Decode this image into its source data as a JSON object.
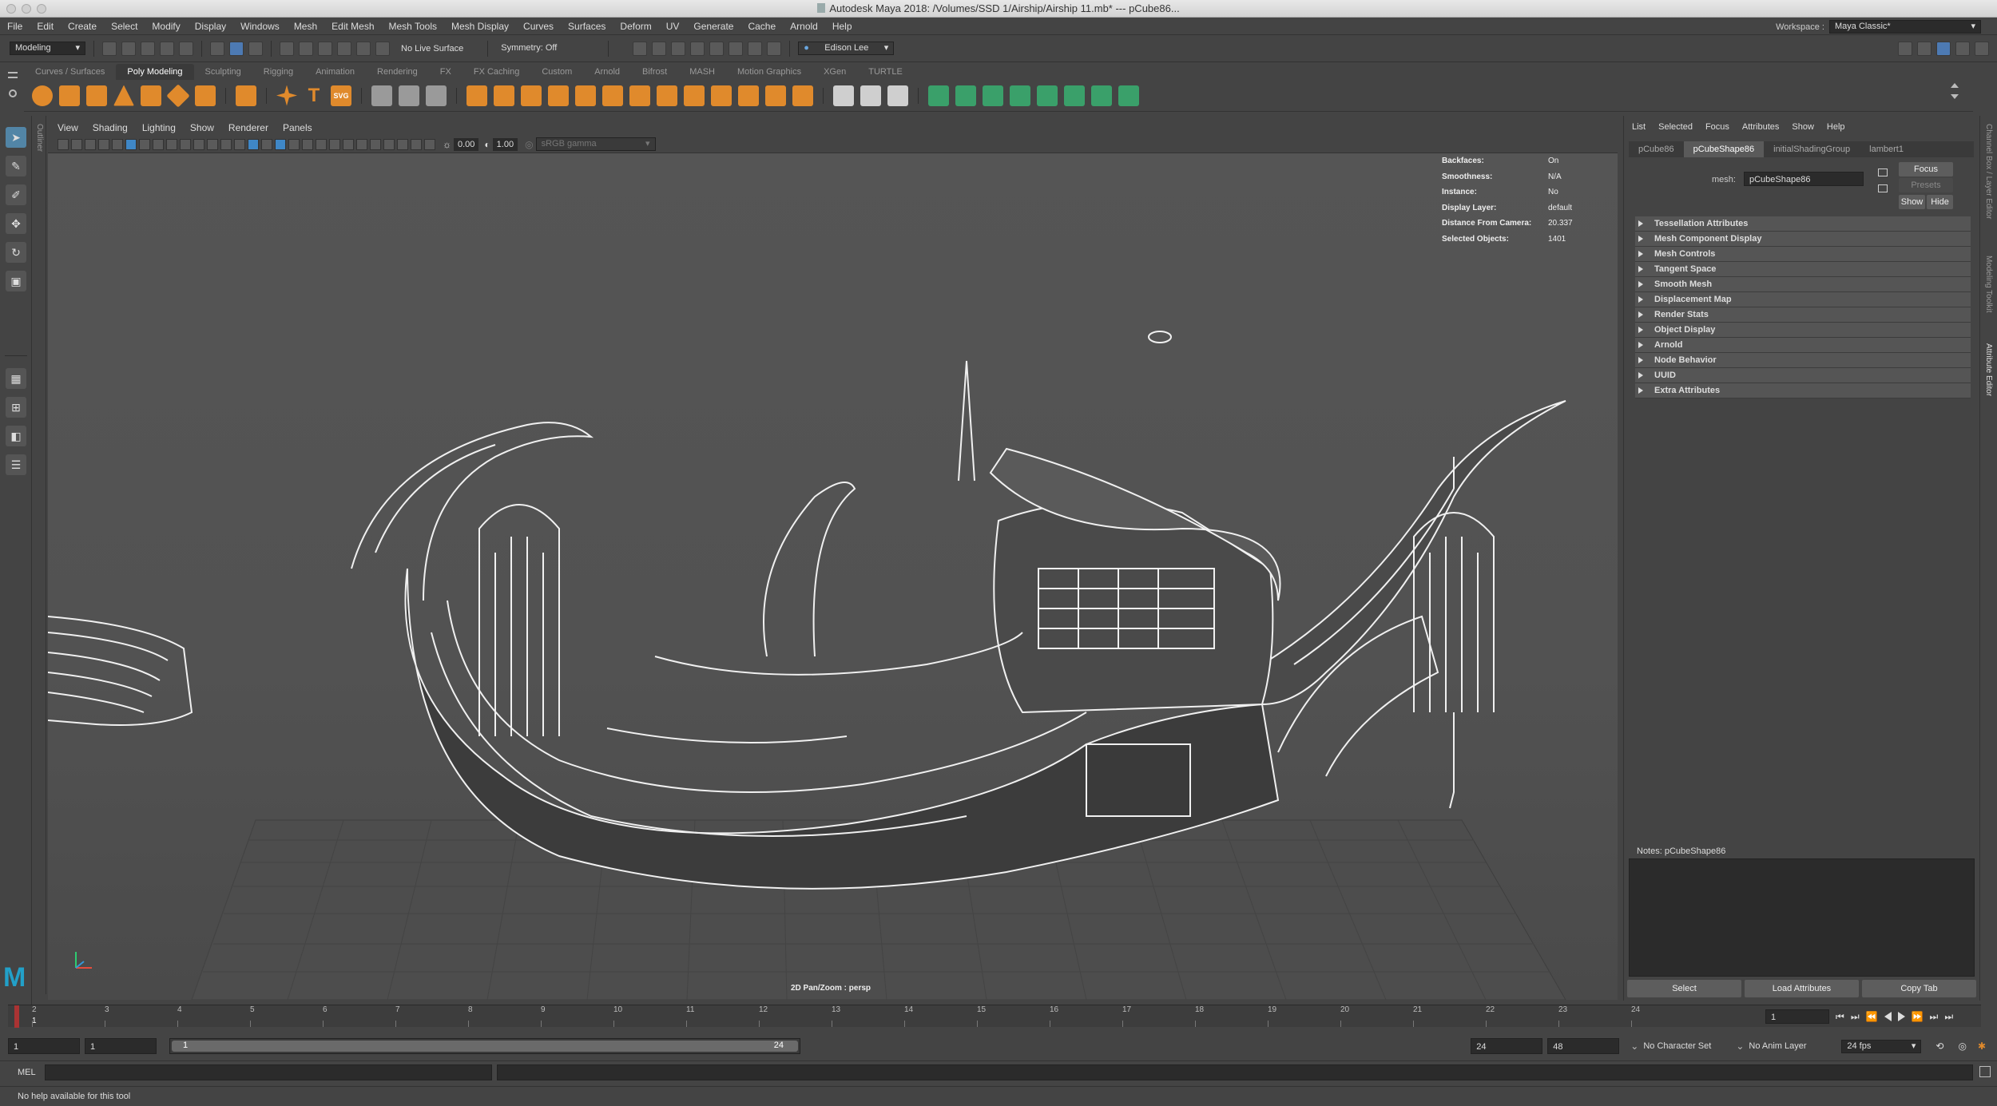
{
  "window": {
    "title": "Autodesk Maya 2018: /Volumes/SSD 1/Airship/Airship 11.mb*  ---  pCube86..."
  },
  "menubar": {
    "items": [
      "File",
      "Edit",
      "Create",
      "Select",
      "Modify",
      "Display",
      "Windows",
      "Mesh",
      "Edit Mesh",
      "Mesh Tools",
      "Mesh Display",
      "Curves",
      "Surfaces",
      "Deform",
      "UV",
      "Generate",
      "Cache",
      "Arnold",
      "Help"
    ],
    "workspace_label": "Workspace :",
    "workspace_value": "Maya Classic*"
  },
  "statusline": {
    "menuset": "Modeling",
    "live_surface": "No Live Surface",
    "symmetry": "Symmetry: Off",
    "user": "Edison Lee"
  },
  "shelf": {
    "tabs": [
      "Curves / Surfaces",
      "Poly Modeling",
      "Sculpting",
      "Rigging",
      "Animation",
      "Rendering",
      "FX",
      "FX Caching",
      "Custom",
      "Arnold",
      "Bifrost",
      "MASH",
      "Motion Graphics",
      "XGen",
      "TURTLE"
    ],
    "active_tab": "Poly Modeling",
    "text_tool_label": "T",
    "svg_tool_label": "SVG"
  },
  "toolbox": {
    "outliner_label": "Outliner",
    "logo": "M"
  },
  "viewport": {
    "menu": [
      "View",
      "Shading",
      "Lighting",
      "Show",
      "Renderer",
      "Panels"
    ],
    "exposure": "0.00",
    "gamma": "1.00",
    "colorspace": "sRGB gamma",
    "hud": [
      {
        "k": "Backfaces:",
        "v": "On"
      },
      {
        "k": "Smoothness:",
        "v": "N/A"
      },
      {
        "k": "Instance:",
        "v": "No"
      },
      {
        "k": "Display Layer:",
        "v": "default"
      },
      {
        "k": "Distance From Camera:",
        "v": "20.337"
      },
      {
        "k": "Selected Objects:",
        "v": "1401"
      }
    ],
    "camera_label": "2D Pan/Zoom : persp"
  },
  "attribute_editor": {
    "menu": [
      "List",
      "Selected",
      "Focus",
      "Attributes",
      "Show",
      "Help"
    ],
    "tabs": [
      "pCube86",
      "pCubeShape86",
      "initialShadingGroup",
      "lambert1"
    ],
    "active_tab": "pCubeShape86",
    "mesh_label": "mesh:",
    "mesh_value": "pCubeShape86",
    "focus_btn": "Focus",
    "presets_btn": "Presets",
    "show_btn": "Show",
    "hide_btn": "Hide",
    "sections": [
      "Tessellation Attributes",
      "Mesh Component Display",
      "Mesh Controls",
      "Tangent Space",
      "Smooth Mesh",
      "Displacement Map",
      "Render Stats",
      "Object Display",
      "Arnold",
      "Node Behavior",
      "UUID",
      "Extra Attributes"
    ],
    "notes_label": "Notes:  pCubeShape86",
    "buttons": [
      "Select",
      "Load Attributes",
      "Copy Tab"
    ],
    "side_tabs": [
      "Channel Box / Layer Editor",
      "Modeling Toolkit",
      "Attribute Editor"
    ]
  },
  "timeline": {
    "ticks": [
      "1",
      "2",
      "3",
      "4",
      "5",
      "6",
      "7",
      "8",
      "9",
      "10",
      "11",
      "12",
      "13",
      "14",
      "15",
      "16",
      "17",
      "18",
      "19",
      "20",
      "21",
      "22",
      "23",
      "24"
    ],
    "current_frame": "1",
    "current_frame_field": "1"
  },
  "range": {
    "start": "1",
    "playback_start": "1",
    "range_start": "1",
    "range_end": "24",
    "playback_end": "24",
    "end": "48",
    "character_set": "No Character Set",
    "anim_layer": "No Anim Layer",
    "fps": "24 fps"
  },
  "cmdline": {
    "label": "MEL"
  },
  "helpline": {
    "text": "No help available for this tool"
  }
}
